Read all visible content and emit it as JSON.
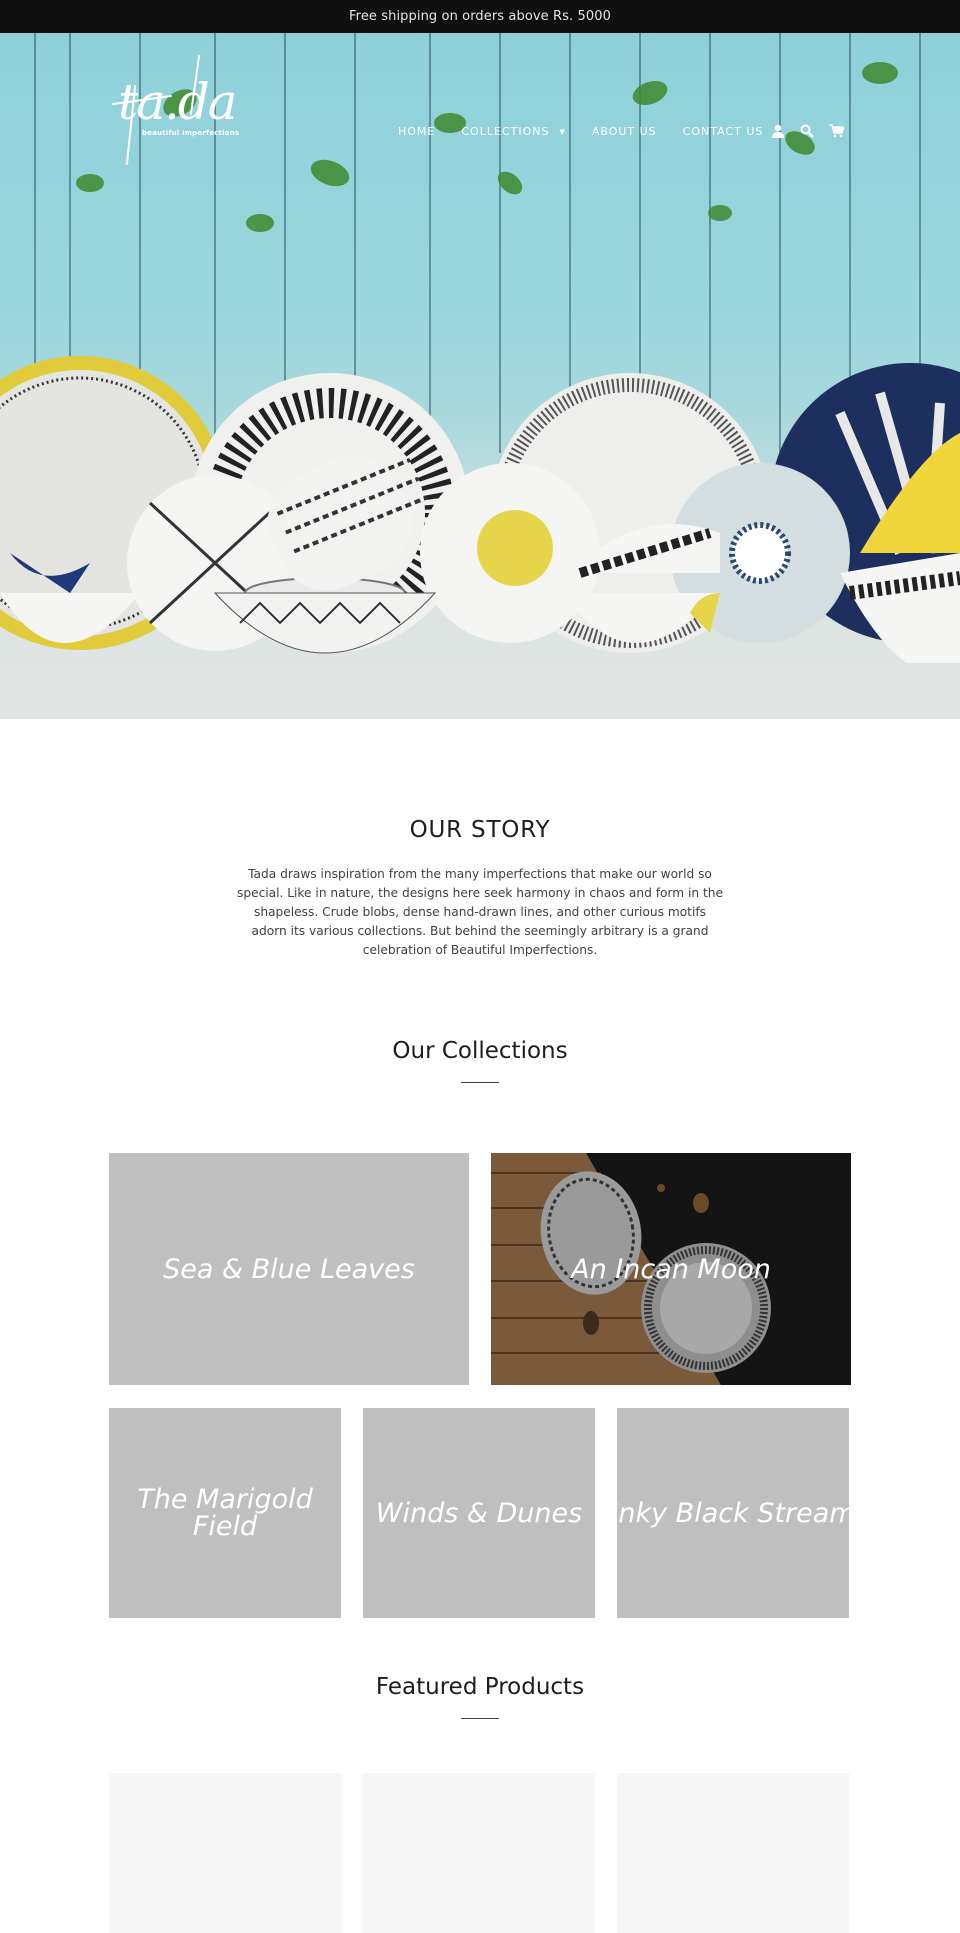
{
  "announcement": {
    "text": "Free shipping on orders above Rs. 5000"
  },
  "header": {
    "logo": {
      "wordmark": "ta.da",
      "tagline": "beautiful imperfections"
    },
    "nav": [
      {
        "label": "HOME"
      },
      {
        "label": "COLLECTIONS",
        "has_dropdown": true
      },
      {
        "label": "ABOUT US"
      },
      {
        "label": "CONTACT US"
      }
    ],
    "icons": [
      "account-icon",
      "search-icon",
      "cart-icon"
    ]
  },
  "story": {
    "title": "OUR STORY",
    "body": "Tada draws inspiration from the many imperfections that make our world so special. Like in nature, the designs here seek harmony in chaos and form in the shapeless. Crude blobs, dense hand-drawn lines, and other curious motifs adorn its various collections. But behind the seemingly arbitrary is a grand celebration of Beautiful Imperfections."
  },
  "collections": {
    "title": "Our Collections",
    "items": [
      {
        "title": "Sea & Blue Leaves"
      },
      {
        "title": "An Incan Moon"
      },
      {
        "title": "The Marigold Field"
      },
      {
        "title": "Winds & Dunes"
      },
      {
        "title": "Inky Black Stream"
      }
    ]
  },
  "featured": {
    "title": "Featured Products",
    "products": [
      {},
      {},
      {}
    ]
  },
  "colors": {
    "announcement_bg": "#0f0f10",
    "tile_placeholder": "#bfbfbf",
    "product_placeholder": "#f6f6f6",
    "text": "#1c1d1d"
  }
}
